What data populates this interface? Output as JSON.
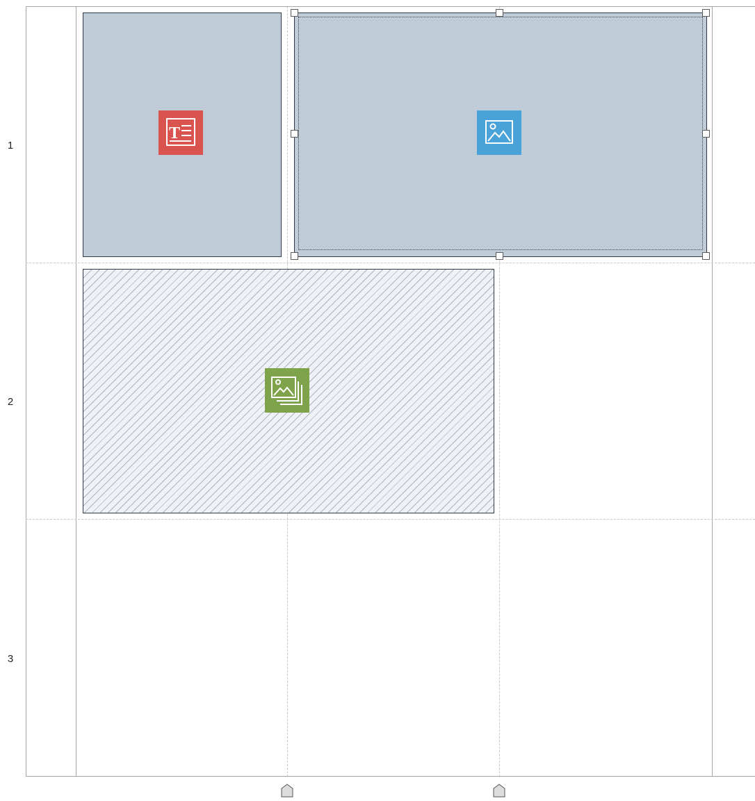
{
  "grid": {
    "rows": [
      {
        "label": "1"
      },
      {
        "label": "2"
      },
      {
        "label": "3"
      }
    ]
  },
  "blocks": [
    {
      "kind": "text",
      "icon": "text-frame-icon",
      "color": "#d9534f",
      "selected": false
    },
    {
      "kind": "image",
      "icon": "image-frame-icon",
      "color": "#4aa3d8",
      "selected": true
    },
    {
      "kind": "image-gallery",
      "icon": "image-gallery-icon",
      "color": "#7fa34a",
      "selected": false,
      "style": "hatched"
    }
  ],
  "colors": {
    "block_fill": "#bfcbd6",
    "block_border": "#2e3b46",
    "grid_line": "#a7a7a7",
    "guide_line": "#c8c8c8"
  }
}
